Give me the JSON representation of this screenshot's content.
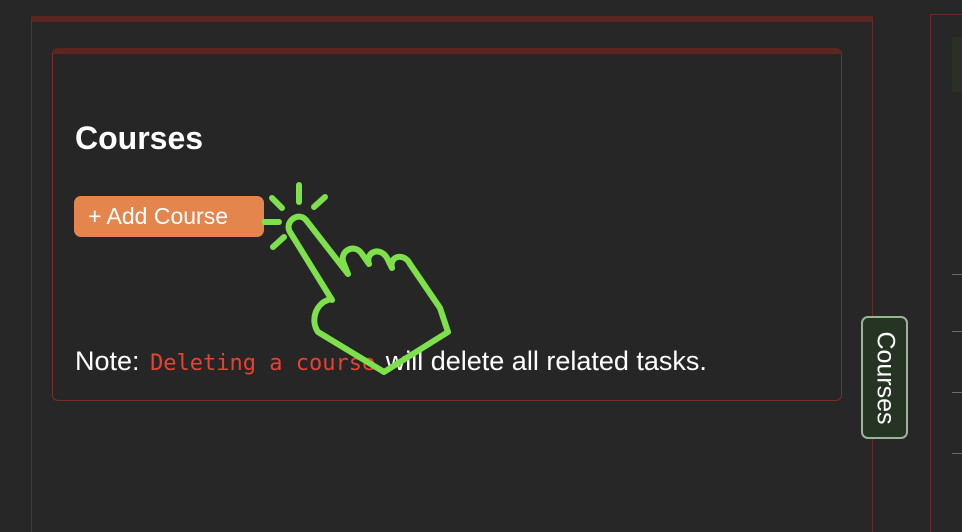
{
  "courses_card": {
    "heading": "Courses",
    "add_button_label": "+ Add Course",
    "note_prefix": "Note:",
    "note_code": "Deleting a course",
    "note_suffix": "will delete all related tasks."
  },
  "side_tab": {
    "label": "Courses"
  },
  "colors": {
    "background": "#272727",
    "panel_border": "#7a2e28",
    "add_button": "#e5854e",
    "code_text": "#e8412f",
    "pointer_hand": "#7ee04a",
    "side_tab_bg": "#263423",
    "side_tab_border": "#9ab596"
  },
  "icons": {
    "pointer": "pointing-hand-click-icon"
  }
}
